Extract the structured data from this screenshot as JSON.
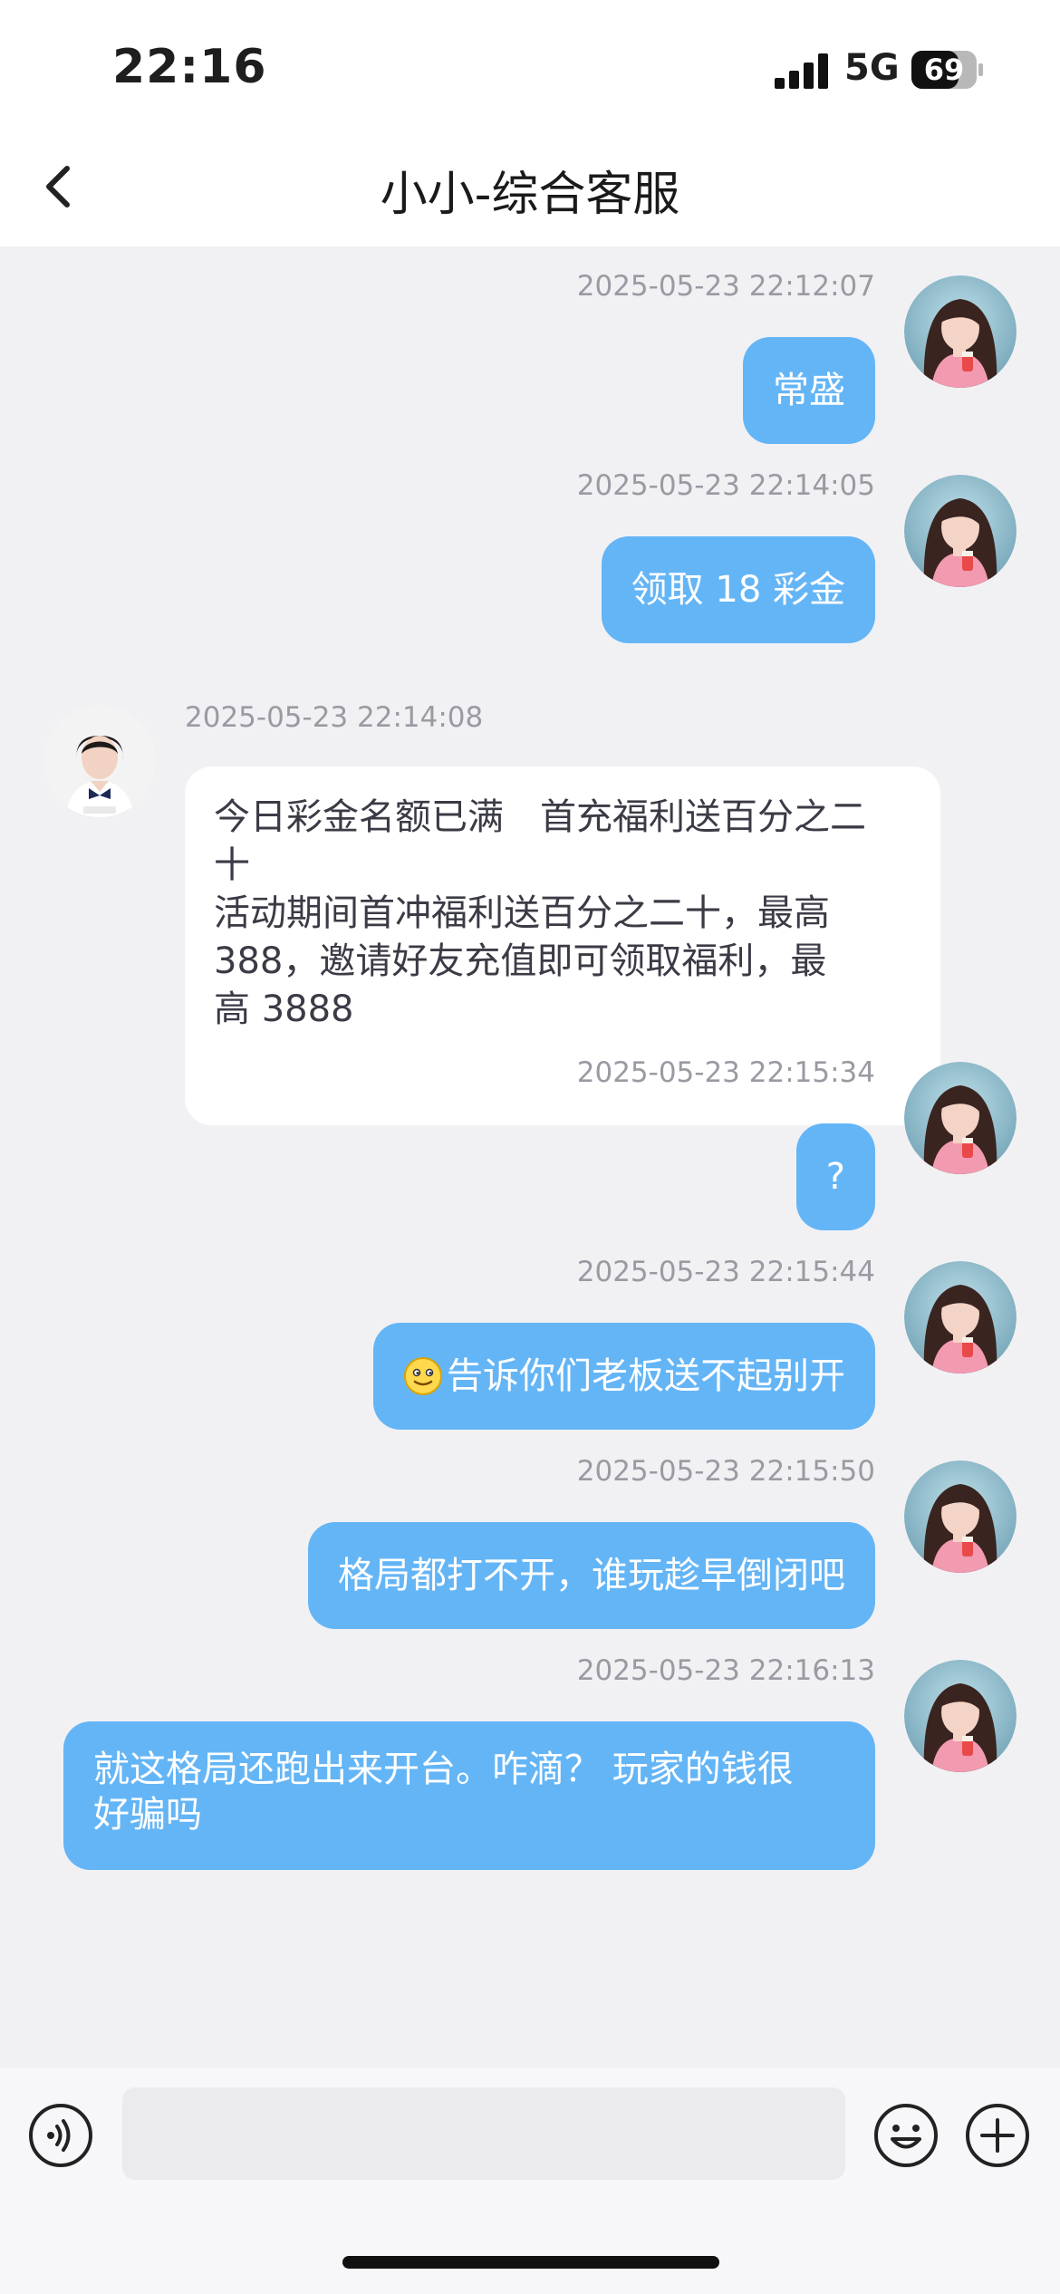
{
  "status_bar": {
    "time": "22:16",
    "network": "5G",
    "battery": "69"
  },
  "header": {
    "title": "小小-综合客服"
  },
  "messages": [
    {
      "side": "out",
      "time": "2025-05-23 22:12:07",
      "text": "常盛"
    },
    {
      "side": "out",
      "time": "2025-05-23 22:14:05",
      "text": "领取 18 彩金"
    },
    {
      "side": "in",
      "time": "2025-05-23 22:14:08",
      "lines": [
        "今日彩金名额已满　首充福利送百分之二",
        "十",
        "活动期间首冲福利送百分之二十，最高",
        "388，邀请好友充值即可领取福利，最",
        "高 3888"
      ]
    },
    {
      "side": "out",
      "time": "2025-05-23 22:15:34",
      "text": "?"
    },
    {
      "side": "out",
      "time": "2025-05-23 22:15:44",
      "emoji": "smiling-face-icon",
      "text": "告诉你们老板送不起别开"
    },
    {
      "side": "out",
      "time": "2025-05-23 22:15:50",
      "text": "格局都打不开，谁玩趁早倒闭吧"
    },
    {
      "side": "out",
      "time": "2025-05-23 22:16:13",
      "lines": [
        "就这格局还跑出来开台。咋滴？ 玩家的钱很",
        "好骗吗"
      ]
    }
  ],
  "input": {
    "placeholder": "",
    "value": ""
  },
  "icons": [
    "back-chevron-icon",
    "voice-icon",
    "emoji-icon",
    "plus-icon",
    "signal-icon",
    "battery-icon"
  ],
  "colors": {
    "outgoing_bubble": "#64b5f6",
    "incoming_bubble": "#ffffff",
    "chat_background": "#f1f1f4",
    "timestamp": "#9a9aa3"
  }
}
